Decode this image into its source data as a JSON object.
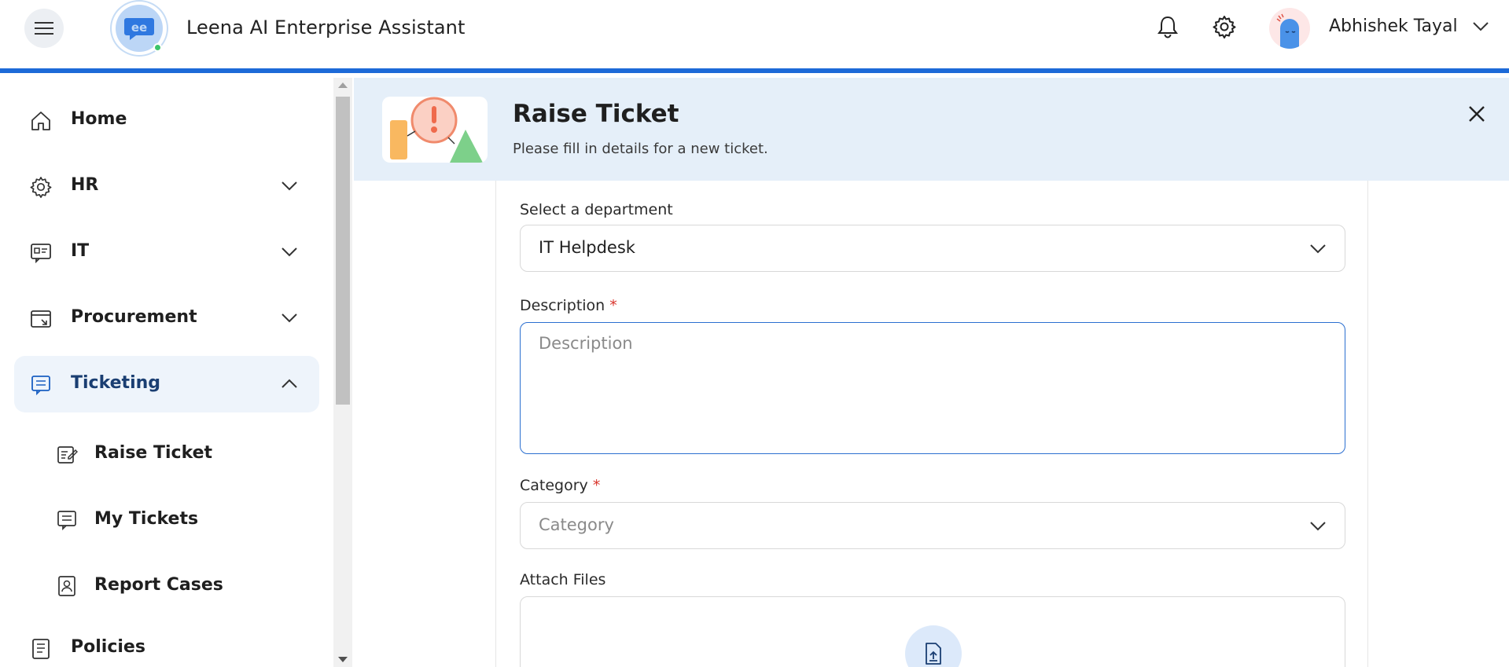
{
  "header": {
    "app_title": "Leena AI Enterprise Assistant",
    "user_name": "Abhishek Tayal",
    "accent_color": "#1d6ad8"
  },
  "sidebar": {
    "items": [
      {
        "label": "Home",
        "icon": "home-icon"
      },
      {
        "label": "HR",
        "icon": "gear-icon"
      },
      {
        "label": "IT",
        "icon": "it-icon"
      },
      {
        "label": "Procurement",
        "icon": "procurement-icon"
      },
      {
        "label": "Ticketing",
        "icon": "ticket-icon"
      },
      {
        "label": "Policies",
        "icon": "document-icon"
      }
    ],
    "sub_items": [
      {
        "label": "Raise Ticket",
        "icon": "edit-ticket-icon"
      },
      {
        "label": "My Tickets",
        "icon": "ticket-list-icon"
      },
      {
        "label": "Report Cases",
        "icon": "report-icon"
      }
    ]
  },
  "banner": {
    "title": "Raise Ticket",
    "subtitle": "Please fill in details for a new ticket."
  },
  "form": {
    "department_label": "Select a department",
    "department_value": "IT Helpdesk",
    "description_label": "Description",
    "description_placeholder": "Description",
    "required_mark": "*",
    "category_label": "Category",
    "category_placeholder": "Category",
    "attach_label": "Attach Files"
  }
}
